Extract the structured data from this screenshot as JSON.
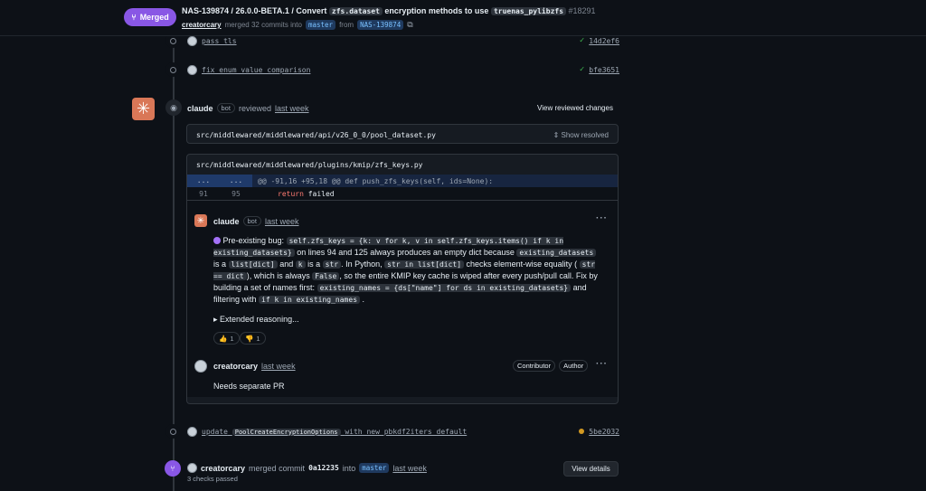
{
  "header": {
    "badge": "Merged",
    "title_prefix": "NAS-139874 / 26.0.0-BETA.1 / Convert",
    "title_code1": "zfs.dataset",
    "title_mid": "encryption methods to use",
    "title_code2": "truenas_pylibzfs",
    "pr_number": "#18291",
    "author": "creatorcary",
    "merged_text": "merged 32 commits into",
    "base_branch": "master",
    "from_text": "from",
    "head_branch": "NAS-139874"
  },
  "commits_top": [
    {
      "message": "pass tls",
      "sha": "14d2ef6",
      "status": "success"
    },
    {
      "message": "fix enum value comparison",
      "sha": "bfe3651",
      "status": "success"
    }
  ],
  "review": {
    "author": "claude",
    "bot_label": "bot",
    "action": "reviewed",
    "time": "last week",
    "view_changes": "View reviewed changes",
    "file1_path": "src/middlewared/middlewared/api/v26_0_0/pool_dataset.py",
    "show_resolved": "Show resolved",
    "file2_path": "src/middlewared/middlewared/plugins/kmip/zfs_keys.py",
    "hunk_left": "...",
    "hunk_right": "...",
    "hunk_text": "@@ -91,16 +95,18 @@ def push_zfs_keys(self, ids=None):",
    "line_old": "91",
    "line_new": "95",
    "line_kw": "return",
    "line_rest": " failed"
  },
  "comment1": {
    "author": "claude",
    "bot_label": "bot",
    "time": "last week",
    "t1": "Pre-existing bug:",
    "c1": "self.zfs_keys = {k: v for k, v in self.zfs_keys.items() if k in existing_datasets}",
    "t2": "on lines 94 and 125 always produces an empty dict because",
    "c2": "existing_datasets",
    "t3": "is a",
    "c3": "list[dict]",
    "t4": "and",
    "c4": "k",
    "t5": "is a",
    "c5": "str",
    "t6": ". In Python,",
    "c6": "str in list[dict]",
    "t7": "checks element-wise equality (",
    "c7": "str == dict",
    "t8": "), which is always",
    "c8": "False",
    "t9": ", so the entire KMIP key cache is wiped after every push/pull call. Fix by building a set of names first:",
    "c9": "existing_names = {ds[\"name\"] for ds in existing_datasets}",
    "t10": "and filtering with",
    "c10": "if k in existing_names",
    "t11": ".",
    "extended": "▸ Extended reasoning...",
    "reaction1_emoji": "👍",
    "reaction1_count": "1",
    "reaction2_emoji": "👎",
    "reaction2_count": "1"
  },
  "comment2": {
    "author": "creatorcary",
    "time": "last week",
    "tag1": "Contributor",
    "tag2": "Author",
    "body": "Needs separate PR"
  },
  "commit_bottom": {
    "message_pre": "update",
    "message_code": "PoolCreateEncryptionOptions",
    "message_post": "with new pbkdf2iters default",
    "sha": "5be2032"
  },
  "merge_event": {
    "author": "creatorcary",
    "text": "merged commit",
    "sha": "0a12235",
    "into": "into",
    "branch": "master",
    "time": "last week",
    "checks": "3 checks passed",
    "button": "View details"
  }
}
